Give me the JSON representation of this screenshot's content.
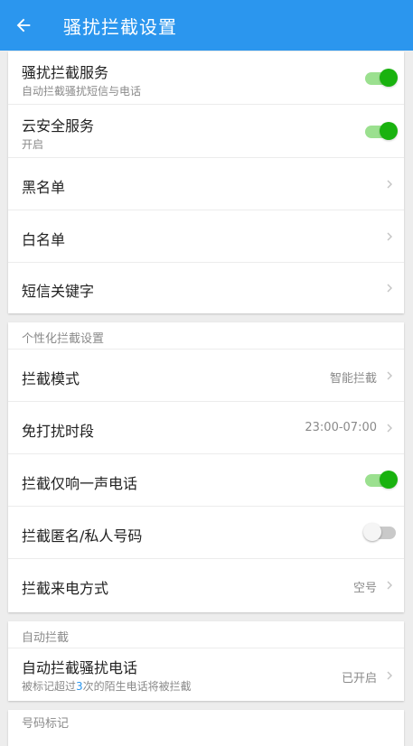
{
  "header": {
    "title": "骚扰拦截设置",
    "back_icon": "arrow-back-icon"
  },
  "colors": {
    "appbar": "#2b96ee",
    "toggle_on": "#19b20f",
    "highlight": "#2b96ee"
  },
  "card1": {
    "rows": [
      {
        "title": "骚扰拦截服务",
        "subtitle": "自动拦截骚扰短信与电话",
        "toggle": true
      },
      {
        "title": "云安全服务",
        "subtitle": "开启",
        "toggle": true
      },
      {
        "title": "黑名单"
      },
      {
        "title": "白名单"
      },
      {
        "title": "短信关键字"
      }
    ]
  },
  "card2": {
    "header": "个性化拦截设置",
    "rows": [
      {
        "title": "拦截模式",
        "value": "智能拦截"
      },
      {
        "title": "免打扰时段",
        "value": "23:00-07:00"
      },
      {
        "title": "拦截仅响一声电话",
        "toggle": true
      },
      {
        "title": "拦截匿名/私人号码",
        "toggle": false
      },
      {
        "title": "拦截来电方式",
        "value": "空号"
      }
    ]
  },
  "card3": {
    "header": "自动拦截",
    "row": {
      "title": "自动拦截骚扰电话",
      "subtitle_pre": "被标记超过",
      "subtitle_num": "3",
      "subtitle_post": "次的陌生电话将被拦截",
      "value": "已开启"
    }
  },
  "card4": {
    "header": "号码标记"
  }
}
